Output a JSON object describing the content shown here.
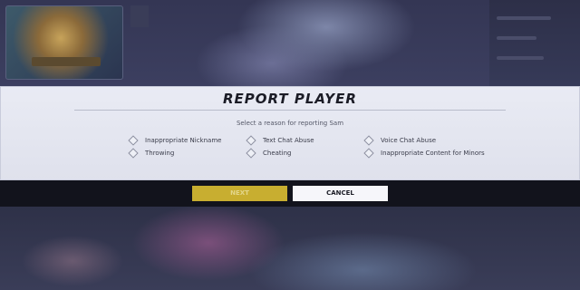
{
  "dialog": {
    "title": "REPORT PLAYER",
    "subtitle": "Select a reason for reporting Sam",
    "options": [
      {
        "label": "Inappropriate Nickname",
        "checked": false
      },
      {
        "label": "Text Chat Abuse",
        "checked": false
      },
      {
        "label": "Voice Chat Abuse",
        "checked": false
      },
      {
        "label": "Throwing",
        "checked": false
      },
      {
        "label": "Cheating",
        "checked": false
      },
      {
        "label": "Inappropriate Content for Minors",
        "checked": false
      }
    ]
  },
  "buttons": {
    "next_label": "NEXT",
    "next_enabled": false,
    "cancel_label": "CANCEL"
  },
  "colors": {
    "accent": "#c8ae30",
    "modal_bg": "#e9ebf4",
    "title_text": "#1b1c26"
  },
  "icons": {
    "option_marker": "diamond-checkbox-icon"
  }
}
